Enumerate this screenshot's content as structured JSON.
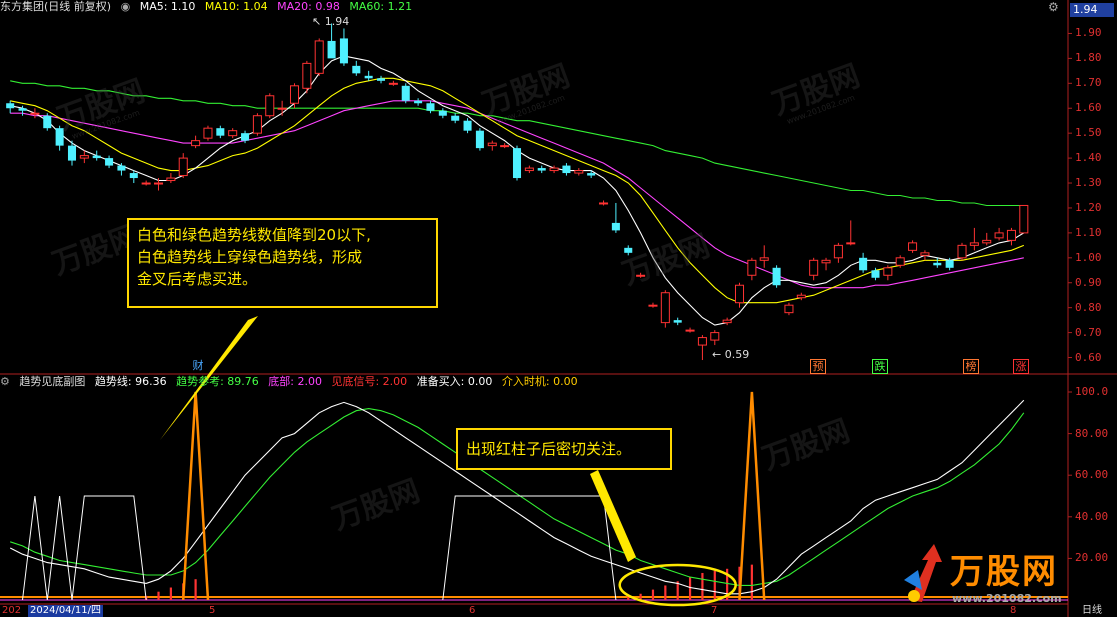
{
  "header": {
    "title": "东方集团(日线 前复权)",
    "indicators": [
      {
        "label": "MA5: 1.10",
        "color": "#ffffff"
      },
      {
        "label": "MA10: 1.04",
        "color": "#ffff00"
      },
      {
        "label": "MA20: 0.98",
        "color": "#ff44ff"
      },
      {
        "label": "MA60: 1.21",
        "color": "#44ff44"
      }
    ],
    "last_price": "1.94"
  },
  "price_axis": [
    "1.90",
    "1.80",
    "1.70",
    "1.60",
    "1.50",
    "1.40",
    "1.30",
    "1.20",
    "1.10",
    "1.00",
    "0.90",
    "0.80",
    "0.70",
    "0.60"
  ],
  "price_markers": {
    "high": "1.94",
    "low": "0.59"
  },
  "event_tags": [
    {
      "label": "财",
      "color": "#4aa8ff"
    },
    {
      "label": "预",
      "color": "#ff7733"
    },
    {
      "label": "跌",
      "color": "#44ff44"
    },
    {
      "label": "榜",
      "color": "#ff7733"
    },
    {
      "label": "涨",
      "color": "#ff3333"
    }
  ],
  "sub_header": {
    "name": "趋势见底副图",
    "items": [
      {
        "label": "趋势线: 96.36",
        "color": "#ffffff"
      },
      {
        "label": "趋势参考: 89.76",
        "color": "#44ff44"
      },
      {
        "label": "底部: 2.00",
        "color": "#ff44ff"
      },
      {
        "label": "见底信号: 2.00",
        "color": "#ff3333"
      },
      {
        "label": "准备买入: 0.00",
        "color": "#ffffff"
      },
      {
        "label": "介入时机: 0.00",
        "color": "#ffcc00"
      }
    ]
  },
  "sub_axis": [
    "100.0",
    "80.00",
    "60.00",
    "40.00",
    "20.00"
  ],
  "callouts": {
    "main": [
      "白色和绿色趋势线数值降到20以下,",
      "白色趋势线上穿绿色趋势线，形成",
      "金叉后考虑买进。"
    ],
    "sub": "出现红柱子后密切关注。"
  },
  "date_axis": {
    "start": "202",
    "selected_date": "2024/04/11/四",
    "months": [
      "5",
      "6",
      "7",
      "8"
    ],
    "period": "日线"
  },
  "watermark": {
    "brand": "万股网",
    "url": "www.201082.com"
  },
  "colors": {
    "up": "#ff3333",
    "down": "#4ff0ff",
    "ma5": "#ffffff",
    "ma10": "#ffff00",
    "ma20": "#ff44ff",
    "ma60": "#33ee33",
    "accent": "#ffd700"
  },
  "chart_data": {
    "type": "candlestick",
    "price_range": [
      0.55,
      1.97
    ],
    "candles": [
      [
        1.62,
        1.63,
        1.58,
        1.6
      ],
      [
        1.6,
        1.61,
        1.57,
        1.59
      ],
      [
        1.58,
        1.6,
        1.56,
        1.58
      ],
      [
        1.57,
        1.58,
        1.51,
        1.52
      ],
      [
        1.52,
        1.53,
        1.43,
        1.45
      ],
      [
        1.45,
        1.47,
        1.37,
        1.39
      ],
      [
        1.4,
        1.43,
        1.38,
        1.41
      ],
      [
        1.41,
        1.43,
        1.39,
        1.4
      ],
      [
        1.4,
        1.41,
        1.36,
        1.37
      ],
      [
        1.37,
        1.38,
        1.33,
        1.35
      ],
      [
        1.34,
        1.35,
        1.3,
        1.32
      ],
      [
        1.3,
        1.31,
        1.29,
        1.3
      ],
      [
        1.3,
        1.32,
        1.27,
        1.3
      ],
      [
        1.31,
        1.34,
        1.3,
        1.32
      ],
      [
        1.33,
        1.42,
        1.32,
        1.4
      ],
      [
        1.45,
        1.49,
        1.44,
        1.47
      ],
      [
        1.48,
        1.53,
        1.47,
        1.52
      ],
      [
        1.52,
        1.53,
        1.48,
        1.49
      ],
      [
        1.49,
        1.52,
        1.48,
        1.51
      ],
      [
        1.5,
        1.51,
        1.46,
        1.47
      ],
      [
        1.5,
        1.58,
        1.49,
        1.57
      ],
      [
        1.57,
        1.66,
        1.56,
        1.65
      ],
      [
        1.6,
        1.63,
        1.57,
        1.6
      ],
      [
        1.62,
        1.7,
        1.6,
        1.69
      ],
      [
        1.68,
        1.79,
        1.66,
        1.78
      ],
      [
        1.74,
        1.88,
        1.73,
        1.87
      ],
      [
        1.87,
        1.94,
        1.85,
        1.8
      ],
      [
        1.88,
        1.92,
        1.77,
        1.78
      ],
      [
        1.77,
        1.79,
        1.73,
        1.74
      ],
      [
        1.73,
        1.75,
        1.71,
        1.72
      ],
      [
        1.72,
        1.73,
        1.7,
        1.71
      ],
      [
        1.7,
        1.71,
        1.69,
        1.7
      ],
      [
        1.69,
        1.7,
        1.62,
        1.63
      ],
      [
        1.63,
        1.64,
        1.61,
        1.62
      ],
      [
        1.62,
        1.63,
        1.58,
        1.59
      ],
      [
        1.59,
        1.6,
        1.56,
        1.57
      ],
      [
        1.57,
        1.58,
        1.54,
        1.55
      ],
      [
        1.55,
        1.56,
        1.5,
        1.51
      ],
      [
        1.51,
        1.52,
        1.43,
        1.44
      ],
      [
        1.45,
        1.47,
        1.43,
        1.46
      ],
      [
        1.45,
        1.46,
        1.44,
        1.45
      ],
      [
        1.44,
        1.45,
        1.31,
        1.32
      ],
      [
        1.35,
        1.37,
        1.34,
        1.36
      ],
      [
        1.36,
        1.37,
        1.34,
        1.35
      ],
      [
        1.35,
        1.37,
        1.34,
        1.36
      ],
      [
        1.37,
        1.38,
        1.33,
        1.34
      ],
      [
        1.34,
        1.36,
        1.33,
        1.35
      ],
      [
        1.34,
        1.35,
        1.32,
        1.33
      ],
      [
        1.22,
        1.23,
        1.21,
        1.22
      ],
      [
        1.14,
        1.22,
        1.1,
        1.11
      ],
      [
        1.04,
        1.05,
        1.01,
        1.02
      ],
      [
        0.93,
        0.94,
        0.92,
        0.93
      ],
      [
        0.81,
        0.82,
        0.8,
        0.81
      ],
      [
        0.74,
        0.87,
        0.72,
        0.86
      ],
      [
        0.75,
        0.76,
        0.73,
        0.74
      ],
      [
        0.71,
        0.72,
        0.7,
        0.71
      ],
      [
        0.65,
        0.69,
        0.59,
        0.68
      ],
      [
        0.67,
        0.71,
        0.65,
        0.7
      ],
      [
        0.74,
        0.76,
        0.73,
        0.75
      ],
      [
        0.82,
        0.9,
        0.8,
        0.89
      ],
      [
        0.93,
        1.0,
        0.91,
        0.99
      ],
      [
        0.99,
        1.05,
        0.96,
        1.0
      ],
      [
        0.96,
        0.97,
        0.88,
        0.89
      ],
      [
        0.78,
        0.82,
        0.77,
        0.81
      ],
      [
        0.84,
        0.86,
        0.83,
        0.85
      ],
      [
        0.93,
        1.0,
        0.91,
        0.99
      ],
      [
        0.98,
        1.0,
        0.95,
        0.99
      ],
      [
        1.0,
        1.06,
        0.98,
        1.05
      ],
      [
        1.06,
        1.15,
        1.05,
        1.06
      ],
      [
        1.0,
        1.02,
        0.94,
        0.95
      ],
      [
        0.95,
        0.96,
        0.91,
        0.92
      ],
      [
        0.93,
        0.97,
        0.91,
        0.96
      ],
      [
        0.97,
        1.01,
        0.96,
        1.0
      ],
      [
        1.03,
        1.07,
        1.02,
        1.06
      ],
      [
        1.01,
        1.03,
        0.99,
        1.02
      ],
      [
        0.98,
        1.0,
        0.96,
        0.97
      ],
      [
        0.99,
        1.0,
        0.95,
        0.96
      ],
      [
        1.0,
        1.06,
        0.99,
        1.05
      ],
      [
        1.05,
        1.12,
        1.03,
        1.06
      ],
      [
        1.06,
        1.1,
        1.05,
        1.07
      ],
      [
        1.08,
        1.12,
        1.07,
        1.1
      ],
      [
        1.07,
        1.12,
        1.05,
        1.11
      ],
      [
        1.1,
        1.21,
        1.1,
        1.21
      ]
    ],
    "ma5": [
      1.61,
      1.6,
      1.58,
      1.55,
      1.5,
      1.46,
      1.43,
      1.41,
      1.39,
      1.37,
      1.35,
      1.33,
      1.31,
      1.31,
      1.33,
      1.36,
      1.4,
      1.44,
      1.47,
      1.49,
      1.51,
      1.55,
      1.58,
      1.62,
      1.67,
      1.74,
      1.79,
      1.81,
      1.8,
      1.79,
      1.76,
      1.74,
      1.71,
      1.67,
      1.64,
      1.61,
      1.59,
      1.57,
      1.53,
      1.5,
      1.47,
      1.43,
      1.4,
      1.38,
      1.36,
      1.35,
      1.35,
      1.35,
      1.32,
      1.27,
      1.19,
      1.1,
      1.0,
      0.92,
      0.86,
      0.81,
      0.76,
      0.73,
      0.74,
      0.78,
      0.84,
      0.88,
      0.91,
      0.91,
      0.9,
      0.89,
      0.9,
      0.93,
      0.97,
      0.99,
      0.99,
      0.98,
      0.98,
      0.99,
      1.01,
      1.0,
      0.99,
      1.0,
      1.02,
      1.04,
      1.06,
      1.07,
      1.1
    ],
    "ma10": [
      1.63,
      1.62,
      1.61,
      1.59,
      1.56,
      1.53,
      1.51,
      1.48,
      1.45,
      1.42,
      1.4,
      1.38,
      1.36,
      1.35,
      1.35,
      1.36,
      1.37,
      1.39,
      1.41,
      1.42,
      1.44,
      1.47,
      1.5,
      1.53,
      1.57,
      1.61,
      1.65,
      1.68,
      1.7,
      1.71,
      1.72,
      1.72,
      1.71,
      1.7,
      1.69,
      1.67,
      1.64,
      1.61,
      1.58,
      1.55,
      1.52,
      1.49,
      1.47,
      1.45,
      1.43,
      1.41,
      1.39,
      1.37,
      1.35,
      1.33,
      1.3,
      1.25,
      1.18,
      1.11,
      1.04,
      0.98,
      0.93,
      0.88,
      0.84,
      0.82,
      0.82,
      0.82,
      0.82,
      0.83,
      0.84,
      0.85,
      0.87,
      0.89,
      0.91,
      0.93,
      0.95,
      0.96,
      0.97,
      0.98,
      0.99,
      0.99,
      0.99,
      0.99,
      1.0,
      1.01,
      1.02,
      1.03,
      1.05
    ],
    "ma20": [
      1.58,
      1.58,
      1.57,
      1.57,
      1.56,
      1.55,
      1.54,
      1.53,
      1.52,
      1.51,
      1.5,
      1.49,
      1.48,
      1.47,
      1.46,
      1.46,
      1.46,
      1.46,
      1.46,
      1.47,
      1.48,
      1.49,
      1.5,
      1.51,
      1.53,
      1.55,
      1.57,
      1.59,
      1.6,
      1.61,
      1.62,
      1.63,
      1.63,
      1.63,
      1.63,
      1.62,
      1.61,
      1.6,
      1.58,
      1.56,
      1.54,
      1.52,
      1.5,
      1.48,
      1.46,
      1.44,
      1.42,
      1.4,
      1.38,
      1.35,
      1.32,
      1.28,
      1.24,
      1.2,
      1.16,
      1.12,
      1.08,
      1.04,
      1.01,
      0.99,
      0.97,
      0.95,
      0.93,
      0.91,
      0.89,
      0.88,
      0.88,
      0.88,
      0.88,
      0.88,
      0.89,
      0.89,
      0.9,
      0.91,
      0.92,
      0.93,
      0.94,
      0.95,
      0.96,
      0.97,
      0.98,
      0.99,
      1.0
    ],
    "ma60": [
      1.71,
      1.7,
      1.7,
      1.69,
      1.69,
      1.68,
      1.68,
      1.67,
      1.67,
      1.66,
      1.65,
      1.65,
      1.64,
      1.64,
      1.63,
      1.63,
      1.62,
      1.62,
      1.61,
      1.61,
      1.6,
      1.6,
      1.6,
      1.6,
      1.6,
      1.6,
      1.6,
      1.6,
      1.6,
      1.6,
      1.6,
      1.6,
      1.6,
      1.6,
      1.59,
      1.59,
      1.58,
      1.58,
      1.57,
      1.57,
      1.56,
      1.55,
      1.55,
      1.54,
      1.53,
      1.52,
      1.51,
      1.5,
      1.49,
      1.48,
      1.47,
      1.46,
      1.45,
      1.43,
      1.42,
      1.41,
      1.4,
      1.38,
      1.37,
      1.36,
      1.35,
      1.34,
      1.33,
      1.32,
      1.31,
      1.3,
      1.29,
      1.28,
      1.27,
      1.27,
      1.26,
      1.25,
      1.25,
      1.24,
      1.24,
      1.23,
      1.23,
      1.22,
      1.22,
      1.21,
      1.21,
      1.21,
      1.21
    ],
    "sub_range": [
      0,
      100
    ],
    "trend_line": [
      25,
      22,
      20,
      18,
      17,
      16,
      15,
      13,
      11,
      10,
      9,
      8,
      10,
      14,
      20,
      28,
      36,
      44,
      52,
      60,
      66,
      72,
      78,
      80,
      85,
      90,
      93,
      95,
      93,
      90,
      86,
      82,
      78,
      74,
      70,
      66,
      62,
      58,
      54,
      50,
      46,
      42,
      38,
      34,
      30,
      27,
      24,
      21,
      19,
      17,
      15,
      13,
      11,
      9,
      8,
      6,
      5,
      4,
      3,
      3,
      4,
      6,
      10,
      16,
      22,
      26,
      30,
      34,
      38,
      44,
      48,
      50,
      52,
      54,
      56,
      58,
      62,
      66,
      72,
      78,
      84,
      90,
      96
    ],
    "trend_ref": [
      28,
      26,
      23,
      21,
      19,
      18,
      17,
      16,
      15,
      14,
      13,
      12,
      12,
      12,
      14,
      18,
      24,
      31,
      38,
      45,
      52,
      59,
      65,
      71,
      76,
      80,
      84,
      88,
      91,
      92,
      91,
      89,
      86,
      83,
      79,
      75,
      71,
      67,
      63,
      59,
      55,
      51,
      47,
      43,
      39,
      36,
      33,
      30,
      27,
      24,
      22,
      19,
      17,
      15,
      13,
      11,
      10,
      9,
      8,
      7,
      7,
      8,
      9,
      12,
      16,
      20,
      24,
      28,
      32,
      36,
      40,
      44,
      47,
      50,
      52,
      54,
      57,
      61,
      65,
      70,
      75,
      82,
      90
    ],
    "bottom_signal_bars": [
      0,
      0,
      0,
      0,
      0,
      0,
      0,
      0,
      0,
      0,
      0,
      2,
      4,
      6,
      8,
      10,
      0,
      0,
      0,
      0,
      0,
      0,
      0,
      0,
      0,
      0,
      0,
      0,
      0,
      0,
      0,
      0,
      0,
      0,
      0,
      0,
      0,
      0,
      0,
      0,
      0,
      0,
      0,
      0,
      0,
      0,
      0,
      0,
      0,
      0,
      2,
      3,
      5,
      7,
      9,
      11,
      13,
      14,
      15,
      16,
      17,
      0,
      0,
      0,
      0,
      0,
      0,
      0,
      0,
      0,
      0,
      0,
      0,
      0,
      0,
      0,
      0,
      0,
      0,
      0,
      0,
      0,
      0
    ]
  }
}
